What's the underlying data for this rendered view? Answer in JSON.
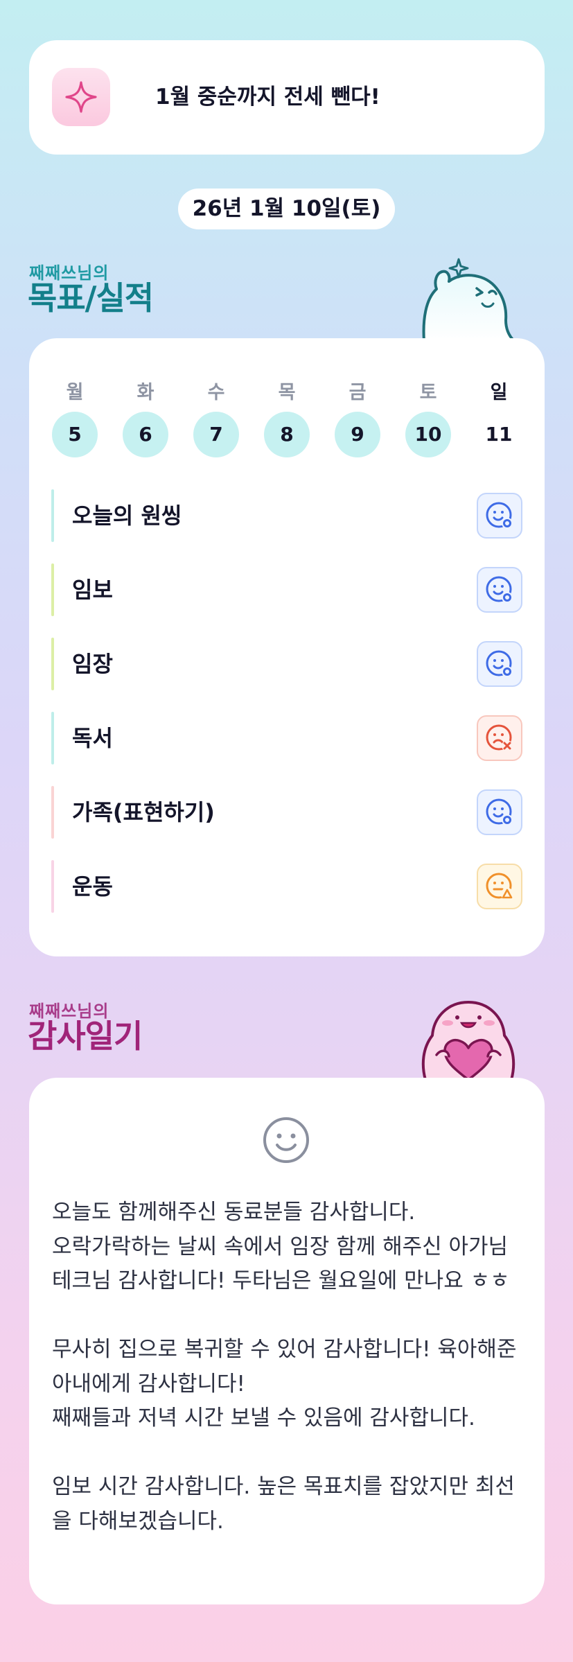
{
  "goal_banner": {
    "icon": "sparkle-icon",
    "text": "1월 중순까지 전세 뺀다!"
  },
  "date": "26년 1월 10일(토)",
  "goals_section": {
    "subtitle": "째째쓰님의",
    "title": "목표/실적"
  },
  "week": {
    "day_names": [
      "월",
      "화",
      "수",
      "목",
      "금",
      "토",
      "일"
    ],
    "dates": [
      "5",
      "6",
      "7",
      "8",
      "9",
      "10",
      "11"
    ]
  },
  "goals": [
    {
      "label": "오늘의 원씽",
      "status": "smile-check-icon",
      "bar_color": "#bfeeea"
    },
    {
      "label": "임보",
      "status": "smile-check-icon",
      "bar_color": "#dcefa6"
    },
    {
      "label": "임장",
      "status": "smile-check-icon",
      "bar_color": "#dcefa6"
    },
    {
      "label": "독서",
      "status": "sad-x-icon",
      "bar_color": "#bfeeea"
    },
    {
      "label": "가족(표현하기)",
      "status": "smile-check-icon",
      "bar_color": "#fad4d4"
    },
    {
      "label": "운동",
      "status": "neutral-warning-icon",
      "bar_color": "#f8d4e6"
    }
  ],
  "thanks_section": {
    "subtitle": "째째쓰님의",
    "title": "감사일기"
  },
  "thanks_icon": "smile-face-icon",
  "thanks_paragraphs": [
    "오늘도 함께해주신 동료분들 감사합니다.\n오락가락하는 날씨 속에서 임장 함께 해주신 아가님 테크님 감사합니다! 두타님은 월요일에 만나요 ㅎㅎ",
    "무사히 집으로 복귀할 수 있어 감사합니다! 육아해준 아내에게 감사합니다!\n째째들과 저녁 시간 보낼 수 있음에 감사합니다.",
    "임보 시간 감사합니다. 높은 목표치를 잡았지만 최선을 다해보겠습니다."
  ],
  "colors": {
    "accent_teal": "#137f8a",
    "accent_magenta": "#a02479",
    "good": "#3e6be6",
    "bad": "#e5533b",
    "warning": "#f0902a"
  }
}
